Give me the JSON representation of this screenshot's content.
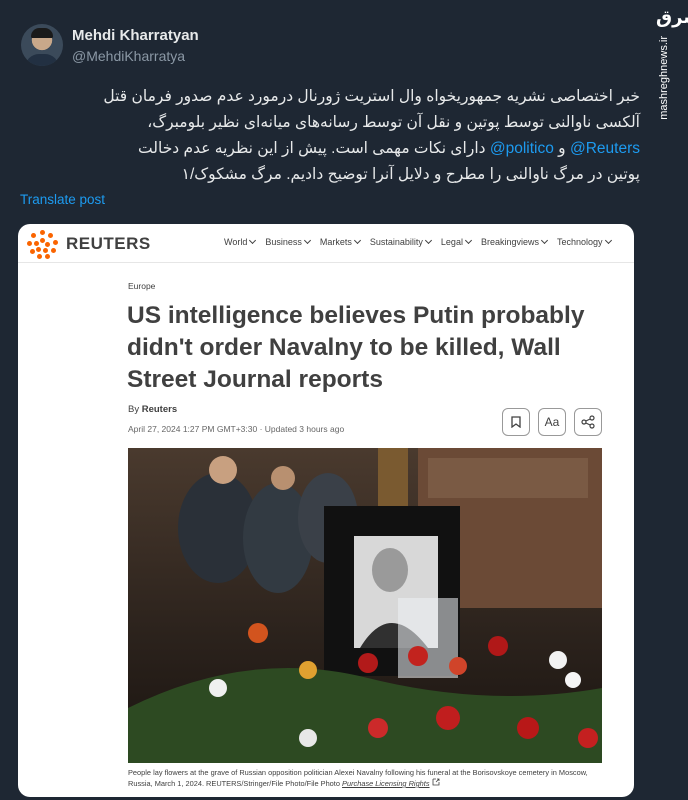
{
  "author": {
    "name": "Mehdi Kharratyan",
    "handle": "@MehdiKharratya"
  },
  "watermark": {
    "logo": "مشرق",
    "url": "mashreghnews.ir"
  },
  "tweet": {
    "line1": "خبر اختصاصی نشریه جمهوریخواه وال استریت ژورنال درمورد عدم صدور فرمان قتل",
    "line2": "آلکسی ناوالنی توسط پوتین و نقل آن توسط رسانه‌های میانه‌ای نظیر بلومبرگ،",
    "mention_reuters": "@Reuters",
    "mention_politico": "@politico",
    "line3_and": "و",
    "line3_rest": "دارای نکات مهمی است. پیش از این نظریه عدم دخالت",
    "line4": "پوتین در مرگ ناوالنی را مطرح و دلایل آنرا توضیح دادیم. مرگ مشکوک/۱"
  },
  "translate_label": "Translate post",
  "reuters": {
    "brand": "REUTERS",
    "nav": [
      "World",
      "Business",
      "Markets",
      "Sustainability",
      "Legal",
      "Breakingviews",
      "Technology"
    ],
    "section": "Europe",
    "headline": "US intelligence believes Putin probably didn't order Navalny to be killed, Wall Street Journal reports",
    "byline_prefix": "By",
    "byline_author": "Reuters",
    "dateline": "April 27, 2024 1:27 PM GMT+3:30 · Updated 3 hours ago",
    "font_size_button": "Aa",
    "caption": "People lay flowers at the grave of Russian opposition politician Alexei Navalny following his funeral at the Borisovskoye cemetery in Moscow, Russia, March 1, 2024. REUTERS/Stringer/File Photo/File Photo",
    "license_link": "Purchase Licensing Rights"
  },
  "colors": {
    "background": "#1e2733",
    "link": "#1d9bf0",
    "reuters_orange": "#fa6400"
  }
}
